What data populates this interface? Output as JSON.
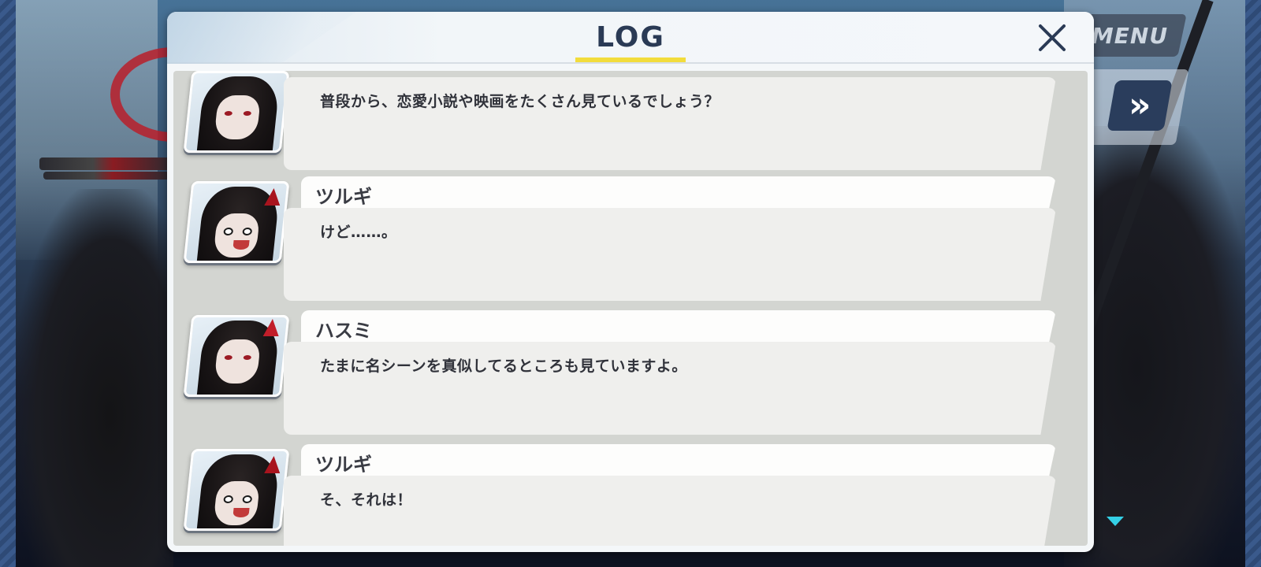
{
  "hud": {
    "menu_label": "MENU",
    "skip_icon": "»"
  },
  "log": {
    "title": "LOG",
    "close_icon": "close-x",
    "entries": [
      {
        "speaker": "",
        "avatar": "hasumi-portrait",
        "text": "普段から、恋愛小説や映画をたくさん見ているでしょう？"
      },
      {
        "speaker": "ツルギ",
        "avatar": "tsurugi-portrait",
        "text": "けど……。"
      },
      {
        "speaker": "ハスミ",
        "avatar": "hasumi-portrait",
        "text": "たまに名シーンを真似してるところも見ていますよ。"
      },
      {
        "speaker": "ツルギ",
        "avatar": "tsurugi-portrait",
        "text": "そ、それは！"
      }
    ]
  },
  "colors": {
    "title_underline": "#f2dc3c",
    "title_text": "#2a3a55",
    "accent_red": "#c11e2a",
    "skip_button": "#2a3d5c"
  }
}
